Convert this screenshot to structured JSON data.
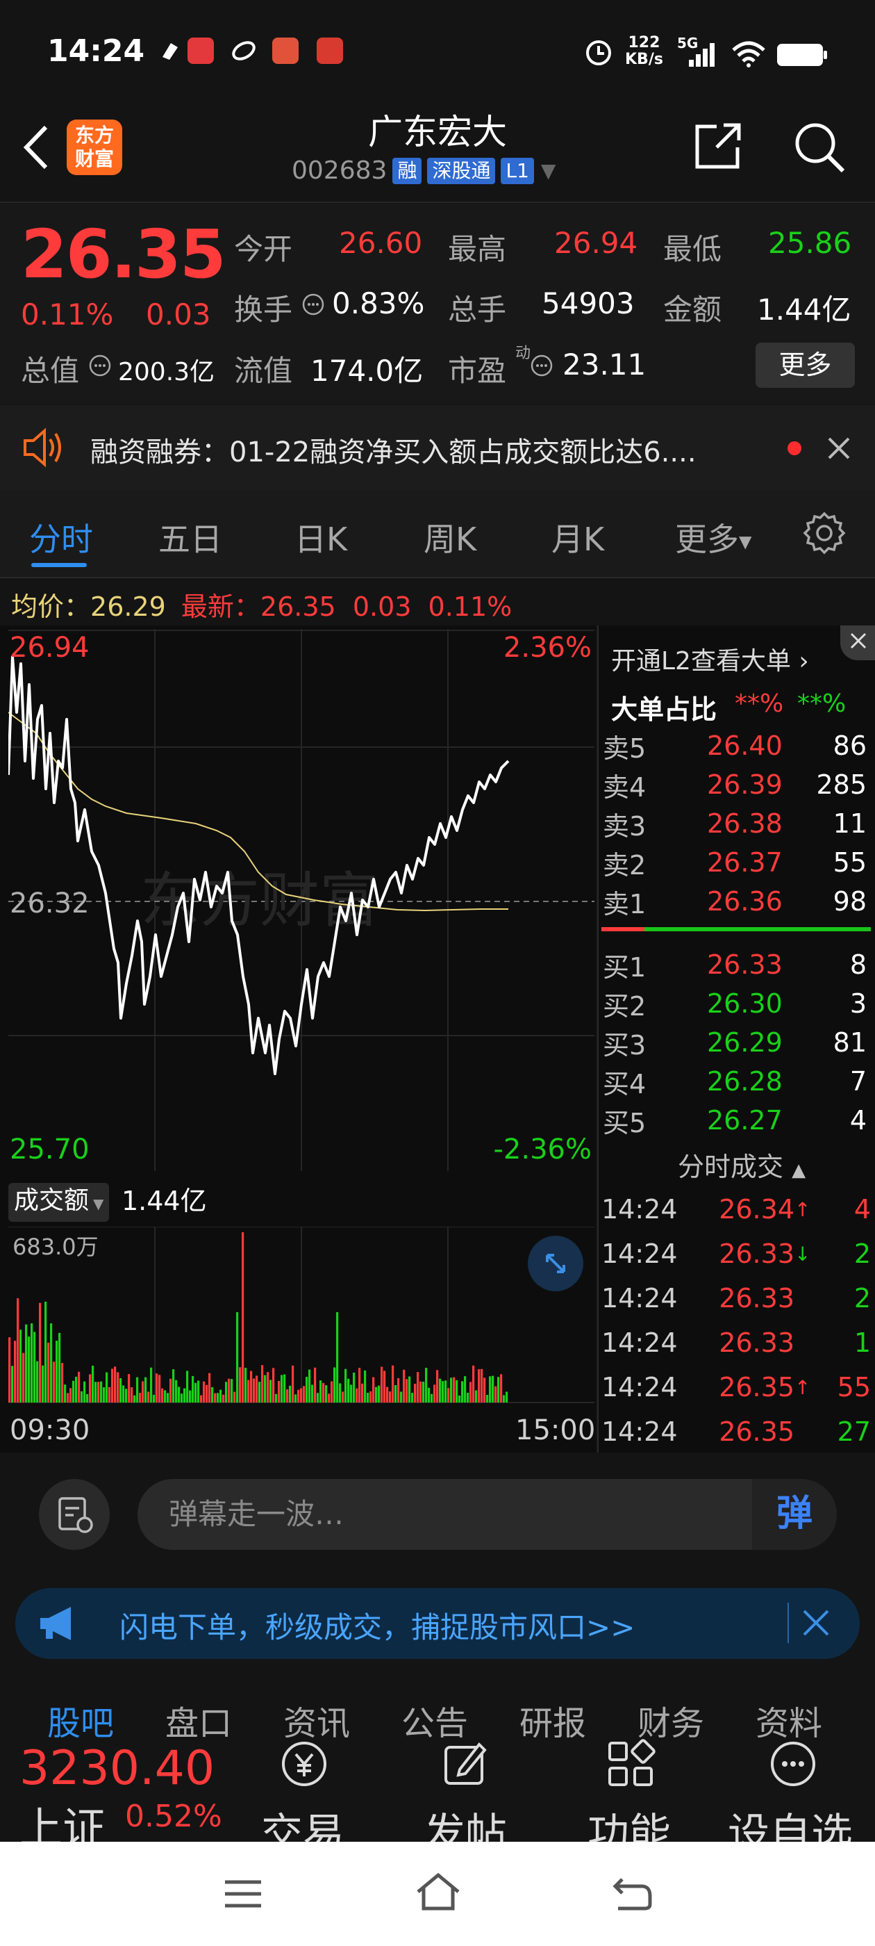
{
  "status": {
    "time": "14:24",
    "net_speed": "122",
    "net_unit": "KB/s",
    "network": "5G"
  },
  "header": {
    "title": "广东宏大",
    "code": "002683",
    "tags": [
      "融",
      "深股通",
      "L1"
    ],
    "logo_line1": "东方",
    "logo_line2": "财富"
  },
  "quote": {
    "last": "26.35",
    "pct": "0.11%",
    "chg": "0.03",
    "open_label": "今开",
    "open": "26.60",
    "high_label": "最高",
    "high": "26.94",
    "low_label": "最低",
    "low": "25.86",
    "turnover_label": "换手",
    "turnover": "0.83%",
    "vol_label": "总手",
    "vol": "54903",
    "amt_label": "金额",
    "amt": "1.44亿",
    "mcap_label": "总值",
    "mcap": "200.3亿",
    "float_label": "流值",
    "float": "174.0亿",
    "pe_label": "市盈",
    "pe_sup": "动",
    "pe": "23.11",
    "more": "更多"
  },
  "margin_banner": {
    "text": "融资融券：01-22融资净买入额占成交额比达6...."
  },
  "tabs": [
    "分时",
    "五日",
    "日K",
    "周K",
    "月K",
    "更多"
  ],
  "chart_info": {
    "avg_label": "均价：",
    "avg": "26.29",
    "last_label": "最新：",
    "last": "26.35",
    "chg": "0.03",
    "pct": "0.11%"
  },
  "chart": {
    "y_top": "26.94",
    "y_mid": "26.32",
    "y_bot": "25.70",
    "pct_top": "2.36%",
    "pct_bot": "-2.36%",
    "vol_label": "成交额",
    "vol_total": "1.44亿",
    "vol_max": "683.0万",
    "t_start": "09:30",
    "t_end": "15:00",
    "watermark": "东方财富"
  },
  "book": {
    "l2_text": "开通L2查看大单",
    "big_label": "大单占比",
    "big_sell": "**%",
    "big_buy": "**%",
    "asks": [
      {
        "label": "卖5",
        "price": "26.40",
        "vol": "86"
      },
      {
        "label": "卖4",
        "price": "26.39",
        "vol": "285"
      },
      {
        "label": "卖3",
        "price": "26.38",
        "vol": "11"
      },
      {
        "label": "卖2",
        "price": "26.37",
        "vol": "55"
      },
      {
        "label": "卖1",
        "price": "26.36",
        "vol": "98"
      }
    ],
    "bids": [
      {
        "label": "买1",
        "price": "26.33",
        "vol": "8"
      },
      {
        "label": "买2",
        "price": "26.30",
        "vol": "3"
      },
      {
        "label": "买3",
        "price": "26.29",
        "vol": "81"
      },
      {
        "label": "买4",
        "price": "26.28",
        "vol": "7"
      },
      {
        "label": "买5",
        "price": "26.27",
        "vol": "4"
      }
    ],
    "ticks_label": "分时成交",
    "ticks": [
      {
        "time": "14:24",
        "price": "26.34",
        "arrow": "↑",
        "vol": "4"
      },
      {
        "time": "14:24",
        "price": "26.33",
        "arrow": "↓",
        "vol": "2"
      },
      {
        "time": "14:24",
        "price": "26.33",
        "arrow": "",
        "vol": "2"
      },
      {
        "time": "14:24",
        "price": "26.33",
        "arrow": "",
        "vol": "1"
      },
      {
        "time": "14:24",
        "price": "26.35",
        "arrow": "↑",
        "vol": "55"
      },
      {
        "time": "14:24",
        "price": "26.35",
        "arrow": "",
        "vol": "27"
      }
    ]
  },
  "danmu": {
    "placeholder": "弹幕走一波…",
    "send": "弹"
  },
  "promo": {
    "text": "闪电下单，秒级成交，捕捉股市风口>>"
  },
  "subtabs": [
    "股吧",
    "盘口",
    "资讯",
    "公告",
    "研报",
    "财务",
    "资料"
  ],
  "nav": {
    "index_price": "3230.40",
    "index_name": "上证",
    "index_pct": "0.52%",
    "items": [
      "交易",
      "发帖",
      "功能",
      "设自选"
    ]
  },
  "colors": {
    "up": "#ff3b3b",
    "down": "#19d119",
    "accent": "#2f8ef0",
    "price_line": "#ffffff",
    "avg_line": "#e8d37a"
  }
}
